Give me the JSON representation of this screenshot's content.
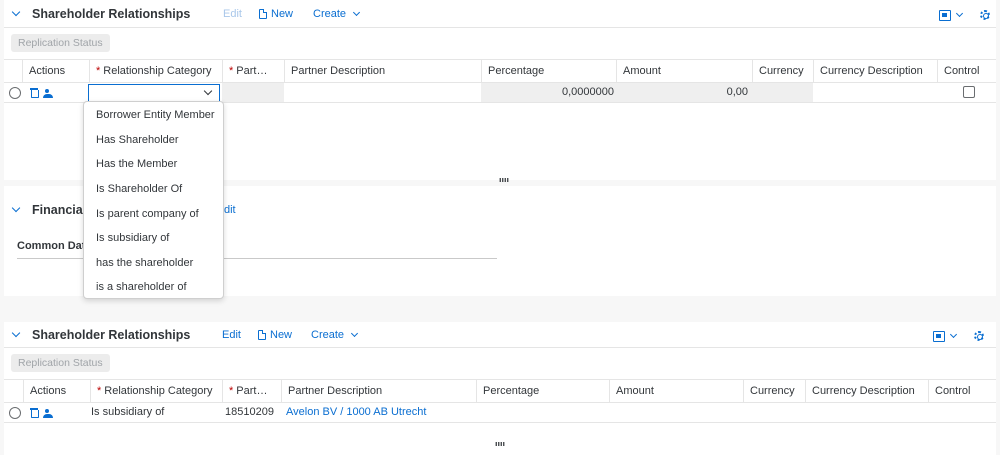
{
  "top_section": {
    "title": "Shareholder Relationships",
    "toolbar": {
      "edit_label": "Edit",
      "new_label": "New",
      "create_label": "Create"
    },
    "replication_status_label": "Replication Status",
    "columns": [
      "Actions",
      "Relationship Category",
      "Part…",
      "Partner Description",
      "Percentage",
      "Amount",
      "Currency",
      "Currency Description",
      "Control"
    ],
    "edit_row": {
      "relationship_category": "",
      "percentage": "0,0000000",
      "amount": "0,00"
    }
  },
  "dropdown": {
    "options": [
      "Borrower Entity Member",
      "Has Shareholder",
      "Has the Member",
      "Is Shareholder Of",
      "Is parent company of",
      "Is subsidiary of",
      "has the shareholder",
      "is a shareholder of"
    ]
  },
  "financial_section": {
    "title_fragment": "Financial",
    "edit_fragment": "dit",
    "common_data_fragment": "Common Dat"
  },
  "bottom_section": {
    "title": "Shareholder Relationships",
    "toolbar": {
      "edit_label": "Edit",
      "new_label": "New",
      "create_label": "Create"
    },
    "replication_status_label": "Replication Status",
    "columns": [
      "Actions",
      "Relationship Category",
      "Part…",
      "Partner Description",
      "Percentage",
      "Amount",
      "Currency",
      "Currency Description",
      "Control"
    ],
    "row": {
      "relationship_category": "Is subsidiary of",
      "partner": "18510209",
      "partner_description": "Avelon BV / 1000 AB Utrecht"
    }
  },
  "colors": {
    "accent": "#0a6ed1",
    "required": "#bb0000"
  }
}
